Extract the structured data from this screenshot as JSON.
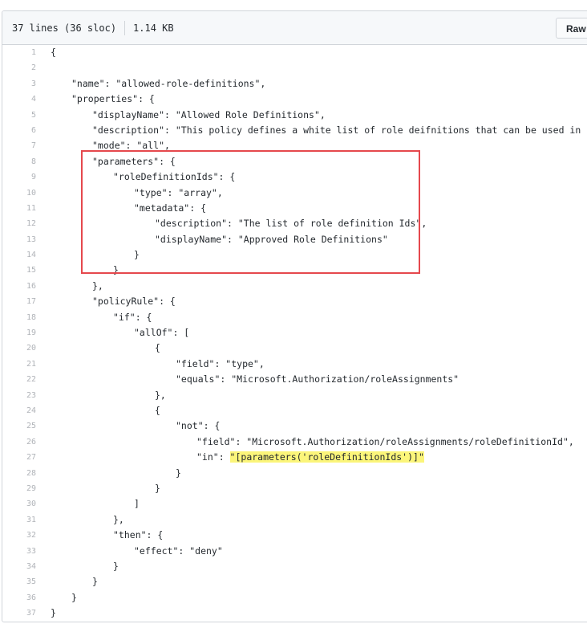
{
  "file_header": {
    "lines_info": "37 lines (36 sloc)",
    "size": "1.14 KB",
    "raw_label": "Raw"
  },
  "code_lines": [
    {
      "n": "1",
      "indent": 0,
      "text": "{"
    },
    {
      "n": "2",
      "indent": 0,
      "text": ""
    },
    {
      "n": "3",
      "indent": 1,
      "text": "\"name\": \"allowed-role-definitions\","
    },
    {
      "n": "4",
      "indent": 1,
      "text": "\"properties\": {"
    },
    {
      "n": "5",
      "indent": 2,
      "text": "\"displayName\": \"Allowed Role Definitions\","
    },
    {
      "n": "6",
      "indent": 2,
      "text": "\"description\": \"This policy defines a white list of role deifnitions that can be used in IAM\","
    },
    {
      "n": "7",
      "indent": 2,
      "text": "\"mode\": \"all\","
    },
    {
      "n": "8",
      "indent": 2,
      "text": "\"parameters\": {"
    },
    {
      "n": "9",
      "indent": 3,
      "text": "\"roleDefinitionIds\": {"
    },
    {
      "n": "10",
      "indent": 4,
      "text": "\"type\": \"array\","
    },
    {
      "n": "11",
      "indent": 4,
      "text": "\"metadata\": {"
    },
    {
      "n": "12",
      "indent": 5,
      "text": "\"description\": \"The list of role definition Ids\","
    },
    {
      "n": "13",
      "indent": 5,
      "text": "\"displayName\": \"Approved Role Definitions\""
    },
    {
      "n": "14",
      "indent": 4,
      "text": "}"
    },
    {
      "n": "15",
      "indent": 3,
      "text": "}"
    },
    {
      "n": "16",
      "indent": 2,
      "text": "},"
    },
    {
      "n": "17",
      "indent": 2,
      "text": "\"policyRule\": {"
    },
    {
      "n": "18",
      "indent": 3,
      "text": "\"if\": {"
    },
    {
      "n": "19",
      "indent": 4,
      "text": "\"allOf\": ["
    },
    {
      "n": "20",
      "indent": 5,
      "text": "{"
    },
    {
      "n": "21",
      "indent": 6,
      "text": "\"field\": \"type\","
    },
    {
      "n": "22",
      "indent": 6,
      "text": "\"equals\": \"Microsoft.Authorization/roleAssignments\""
    },
    {
      "n": "23",
      "indent": 5,
      "text": "},"
    },
    {
      "n": "24",
      "indent": 5,
      "text": "{"
    },
    {
      "n": "25",
      "indent": 6,
      "text": "\"not\": {"
    },
    {
      "n": "26",
      "indent": 7,
      "text": "\"field\": \"Microsoft.Authorization/roleAssignments/roleDefinitionId\","
    },
    {
      "n": "27",
      "indent": 7,
      "text": "\"in\": ",
      "highlight": "\"[parameters('roleDefinitionIds')]\""
    },
    {
      "n": "28",
      "indent": 6,
      "text": "}"
    },
    {
      "n": "29",
      "indent": 5,
      "text": "}"
    },
    {
      "n": "30",
      "indent": 4,
      "text": "]"
    },
    {
      "n": "31",
      "indent": 3,
      "text": "},"
    },
    {
      "n": "32",
      "indent": 3,
      "text": "\"then\": {"
    },
    {
      "n": "33",
      "indent": 4,
      "text": "\"effect\": \"deny\""
    },
    {
      "n": "34",
      "indent": 3,
      "text": "}"
    },
    {
      "n": "35",
      "indent": 2,
      "text": "}"
    },
    {
      "n": "36",
      "indent": 1,
      "text": "}"
    },
    {
      "n": "37",
      "indent": 0,
      "text": "}"
    }
  ],
  "colors": {
    "highlight": "#fbf57a",
    "annotation_box": "#e5484d"
  }
}
